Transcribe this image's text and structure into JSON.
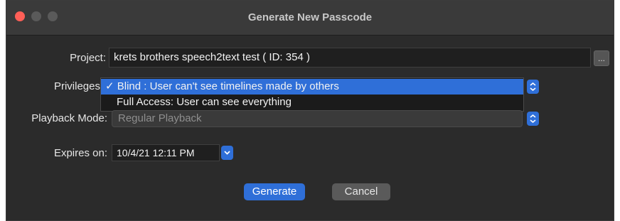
{
  "window": {
    "title": "Generate New Passcode"
  },
  "project": {
    "label": "Project:",
    "value": "krets brothers speech2text test ( ID: 354 )",
    "browse_label": "..."
  },
  "privileges": {
    "label": "Privileges",
    "options": [
      {
        "label": "Blind : User can't see timelines made by others",
        "checkmark": "✓",
        "selected": true
      },
      {
        "label": "Full Access:  User can see everything",
        "selected": false
      }
    ]
  },
  "playback": {
    "label": "Playback Mode:",
    "value": "Regular Playback"
  },
  "expires": {
    "label": "Expires on:",
    "value": "10/4/21 12:11 PM"
  },
  "actions": {
    "generate_label": "Generate",
    "cancel_label": "Cancel"
  },
  "colors": {
    "accent": "#2f6fd8",
    "close": "#ff5f57",
    "window_bg": "#2b2b2b"
  },
  "icons": [
    "close-light",
    "minimize-light",
    "maximize-light",
    "updown-chevron-icon",
    "chevron-down-icon",
    "checkmark-icon"
  ]
}
